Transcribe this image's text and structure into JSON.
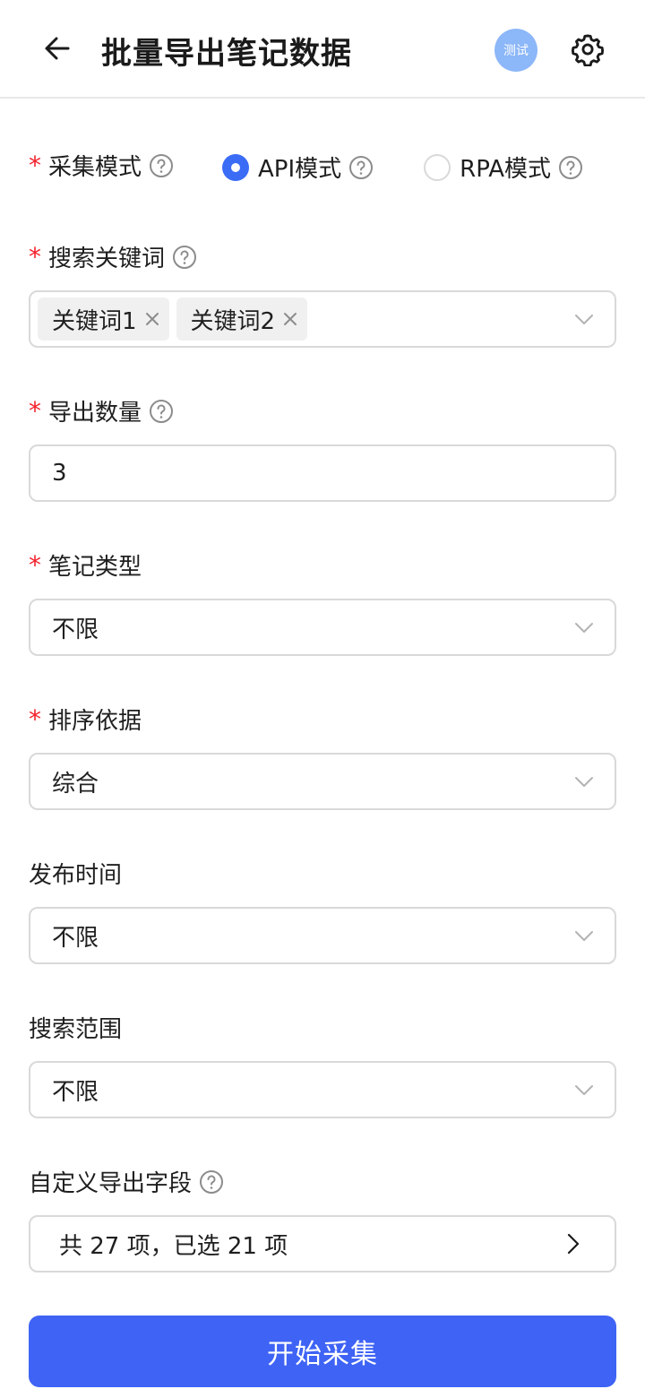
{
  "header": {
    "title": "批量导出笔记数据",
    "badge": "测试"
  },
  "mode": {
    "label": "采集模式",
    "options": [
      {
        "label": "API模式",
        "selected": true
      },
      {
        "label": "RPA模式",
        "selected": false
      }
    ]
  },
  "keywords": {
    "label": "搜索关键词",
    "tags": [
      "关键词1",
      "关键词2"
    ]
  },
  "count": {
    "label": "导出数量",
    "value": "3"
  },
  "note_type": {
    "label": "笔记类型",
    "value": "不限"
  },
  "sort": {
    "label": "排序依据",
    "value": "综合"
  },
  "publish_time": {
    "label": "发布时间",
    "value": "不限"
  },
  "scope": {
    "label": "搜索范围",
    "value": "不限"
  },
  "custom_fields": {
    "label": "自定义导出字段",
    "summary": "共 27 项，已选 21 项"
  },
  "start_button": "开始采集",
  "colors": {
    "primary": "#3e63f5",
    "required": "#f5222d",
    "badge": "#8cb7f8"
  }
}
